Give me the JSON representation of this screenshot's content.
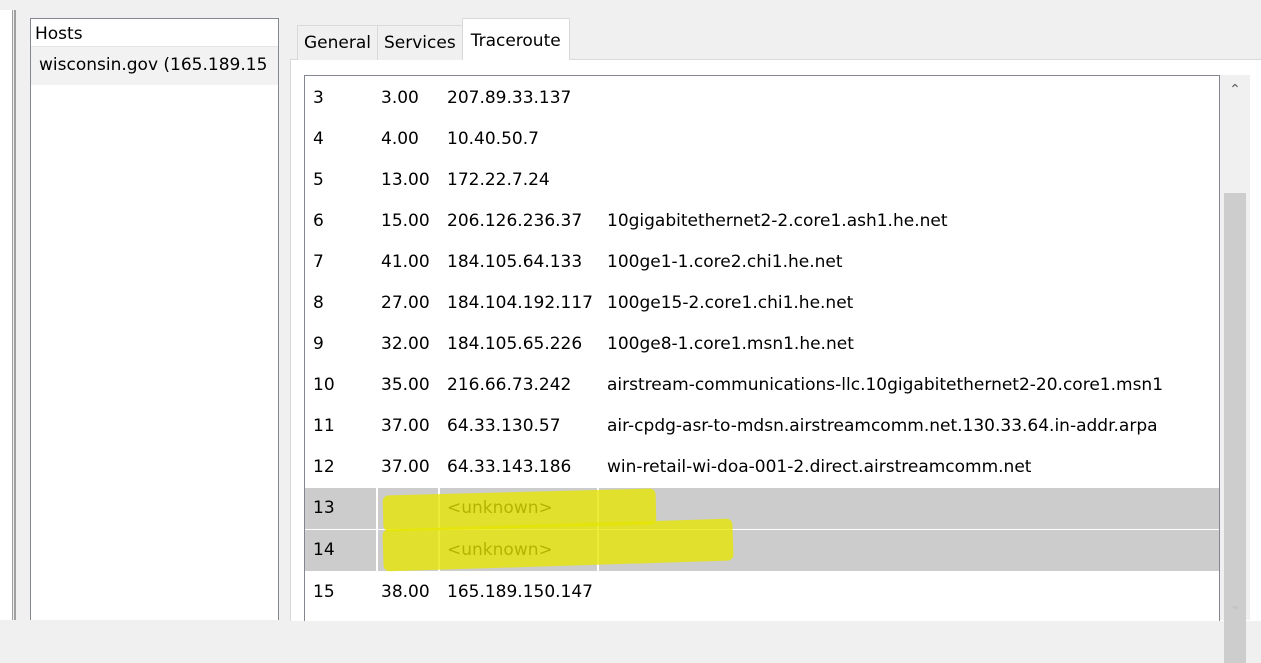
{
  "hosts": {
    "header": "Hosts",
    "items": [
      "wisconsin.gov (165.189.15"
    ]
  },
  "tabs": [
    {
      "label": "General",
      "active": false
    },
    {
      "label": "Services",
      "active": false
    },
    {
      "label": "Traceroute",
      "active": true
    }
  ],
  "traceroute": {
    "rows": [
      {
        "hop": "3",
        "ms": "3.00",
        "ip": "207.89.33.137",
        "name": ""
      },
      {
        "hop": "4",
        "ms": "4.00",
        "ip": "10.40.50.7",
        "name": ""
      },
      {
        "hop": "5",
        "ms": "13.00",
        "ip": "172.22.7.24",
        "name": ""
      },
      {
        "hop": "6",
        "ms": "15.00",
        "ip": "206.126.236.37",
        "name": "10gigabitethernet2-2.core1.ash1.he.net"
      },
      {
        "hop": "7",
        "ms": "41.00",
        "ip": "184.105.64.133",
        "name": "100ge1-1.core2.chi1.he.net"
      },
      {
        "hop": "8",
        "ms": "27.00",
        "ip": "184.104.192.117",
        "name": "100ge15-2.core1.chi1.he.net"
      },
      {
        "hop": "9",
        "ms": "32.00",
        "ip": "184.105.65.226",
        "name": "100ge8-1.core1.msn1.he.net"
      },
      {
        "hop": "10",
        "ms": "35.00",
        "ip": "216.66.73.242",
        "name": "airstream-communications-llc.10gigabitethernet2-20.core1.msn1"
      },
      {
        "hop": "11",
        "ms": "37.00",
        "ip": "64.33.130.57",
        "name": "air-cpdg-asr-to-mdsn.airstreamcomm.net.130.33.64.in-addr.arpa"
      },
      {
        "hop": "12",
        "ms": "37.00",
        "ip": "64.33.143.186",
        "name": "win-retail-wi-doa-001-2.direct.airstreamcomm.net"
      },
      {
        "hop": "13",
        "ms": "",
        "ip": "<unknown>",
        "name": "",
        "gray": true
      },
      {
        "hop": "14",
        "ms": "",
        "ip": "<unknown>",
        "name": "",
        "gray": true
      },
      {
        "hop": "15",
        "ms": "38.00",
        "ip": "165.189.150.147",
        "name": ""
      }
    ]
  },
  "icons": {
    "scroll_up": "chevron-up-icon",
    "scroll_down": "chevron-down-icon"
  },
  "colors": {
    "highlight": "#e6e600",
    "selected_row": "#cccccc"
  }
}
